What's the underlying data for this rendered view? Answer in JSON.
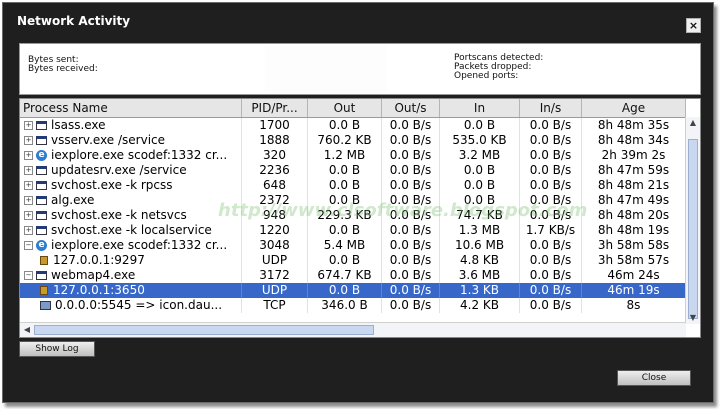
{
  "window": {
    "title": "Network Activity",
    "close_glyph": "×"
  },
  "stats": {
    "bytes_sent_label": "Bytes sent:",
    "bytes_received_label": "Bytes received:",
    "portscans_label": "Portscans detected:",
    "packets_dropped_label": "Packets dropped:",
    "opened_ports_label": "Opened ports:"
  },
  "table": {
    "columns": [
      "Process Name",
      "PID/Pr...",
      "Out",
      "Out/s",
      "In",
      "In/s",
      "Age"
    ],
    "rows": [
      {
        "name": "lsass.exe",
        "pid": "1700",
        "out": "0.0  B",
        "outs": "0.0  B/s",
        "in": "0.0  B",
        "ins": "0.0  B/s",
        "age": "8h 48m 35s",
        "icon": "process-icon",
        "expander": "+"
      },
      {
        "name": "vsserv.exe /service",
        "pid": "1888",
        "out": "760.2  KB",
        "outs": "0.0  B/s",
        "in": "535.0  KB",
        "ins": "0.0  B/s",
        "age": "8h 48m 34s",
        "icon": "process-icon",
        "expander": "+"
      },
      {
        "name": "iexplore.exe scodef:1332 cr...",
        "pid": "320",
        "out": "1.2  MB",
        "outs": "0.0  B/s",
        "in": "3.2  MB",
        "ins": "0.0  B/s",
        "age": "2h 39m 2s",
        "icon": "internet-explorer-icon",
        "expander": "+"
      },
      {
        "name": "updatesrv.exe /service",
        "pid": "2236",
        "out": "0.0  B",
        "outs": "0.0  B/s",
        "in": "0.0  B",
        "ins": "0.0  B/s",
        "age": "8h 47m 59s",
        "icon": "process-icon",
        "expander": "+"
      },
      {
        "name": "svchost.exe -k rpcss",
        "pid": "648",
        "out": "0.0  B",
        "outs": "0.0  B/s",
        "in": "0.0  B",
        "ins": "0.0  B/s",
        "age": "8h 48m 21s",
        "icon": "process-icon",
        "expander": "+"
      },
      {
        "name": "alg.exe",
        "pid": "2372",
        "out": "0.0  B",
        "outs": "0.0  B/s",
        "in": "0.0  B",
        "ins": "0.0  B/s",
        "age": "8h 47m 49s",
        "icon": "process-icon",
        "expander": "+"
      },
      {
        "name": "svchost.exe -k netsvcs",
        "pid": "948",
        "out": "229.3  KB",
        "outs": "0.0  B/s",
        "in": "74.7  KB",
        "ins": "0.0  B/s",
        "age": "8h 48m 20s",
        "icon": "process-icon",
        "expander": "+"
      },
      {
        "name": "svchost.exe -k localservice",
        "pid": "1220",
        "out": "0.0  B",
        "outs": "0.0  B/s",
        "in": "1.3  MB",
        "ins": "1.7  KB/s",
        "age": "8h 48m 19s",
        "icon": "process-icon",
        "expander": "+"
      },
      {
        "name": "iexplore.exe scodef:1332 cr...",
        "pid": "3048",
        "out": "5.4  MB",
        "outs": "0.0  B/s",
        "in": "10.6  MB",
        "ins": "0.0  B/s",
        "age": "3h 58m 58s",
        "icon": "internet-explorer-icon",
        "expander": "−"
      },
      {
        "name": "127.0.0.1:9297",
        "pid": "UDP",
        "out": "0.0  B",
        "outs": "0.0  B/s",
        "in": "4.8  KB",
        "ins": "0.0  B/s",
        "age": "3h 58m 57s",
        "icon": "lock-icon",
        "expander": ""
      },
      {
        "name": "webmap4.exe",
        "pid": "3172",
        "out": "674.7  KB",
        "outs": "0.0  B/s",
        "in": "3.6  MB",
        "ins": "0.0  B/s",
        "age": "46m 24s",
        "icon": "application-icon",
        "expander": "−"
      },
      {
        "name": "127.0.0.1:3650",
        "pid": "UDP",
        "out": "0.0  B",
        "outs": "0.0  B/s",
        "in": "1.3  KB",
        "ins": "0.0  B/s",
        "age": "46m 19s",
        "icon": "lock-icon",
        "expander": "",
        "selected": true
      },
      {
        "name": "0.0.0.0:5545 => icon.dau...",
        "pid": "TCP",
        "out": "346.0  B",
        "outs": "0.0  B/s",
        "in": "4.2  KB",
        "ins": "0.0  B/s",
        "age": "8s",
        "icon": "network-connection-icon",
        "expander": ""
      }
    ]
  },
  "buttons": {
    "show_log": "Show Log",
    "close": "Close"
  },
  "watermark": "http://www.clsoftware.blogspot.com"
}
